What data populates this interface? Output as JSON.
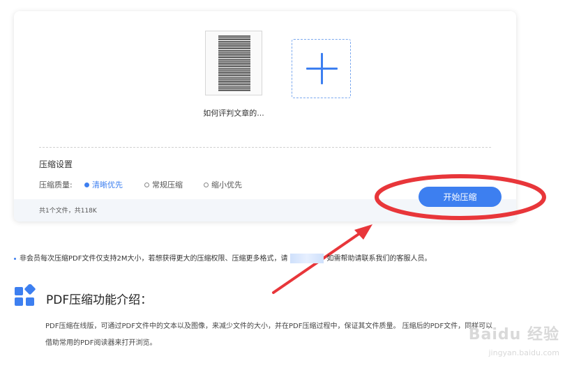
{
  "upload": {
    "file_name": "如何评判文章的...",
    "add_icon": "plus-icon"
  },
  "settings": {
    "title": "压缩设置",
    "quality_label": "压缩质量:",
    "options": [
      {
        "label": "清晰优先",
        "selected": true
      },
      {
        "label": "常规压缩",
        "selected": false
      },
      {
        "label": "缩小优先",
        "selected": false
      }
    ]
  },
  "summary": "共1个文件，共118K",
  "start_button": "开始压缩",
  "notice": {
    "before": "非会员每次压缩PDF文件仅支持2M大小，若想获得更大的压缩权限、压缩更多格式，请",
    "after": "如需帮助请联系我们的客服人员。"
  },
  "intro": {
    "title": "PDF压缩功能介绍：",
    "text_line1": "PDF压缩在线版，可通过PDF文件中的文本以及图像，来减少文件的大小，并在PDF压缩过程中，保证其文件质量。 压缩后的PDF文件，同样可以",
    "text_line2": "借助常用的PDF阅读器来打开浏览。"
  },
  "watermark": {
    "main": "Baidu 经验",
    "sub": "jingyan.baidu.com"
  },
  "colors": {
    "accent": "#3d7ff0",
    "annotation": "#e8363a"
  }
}
